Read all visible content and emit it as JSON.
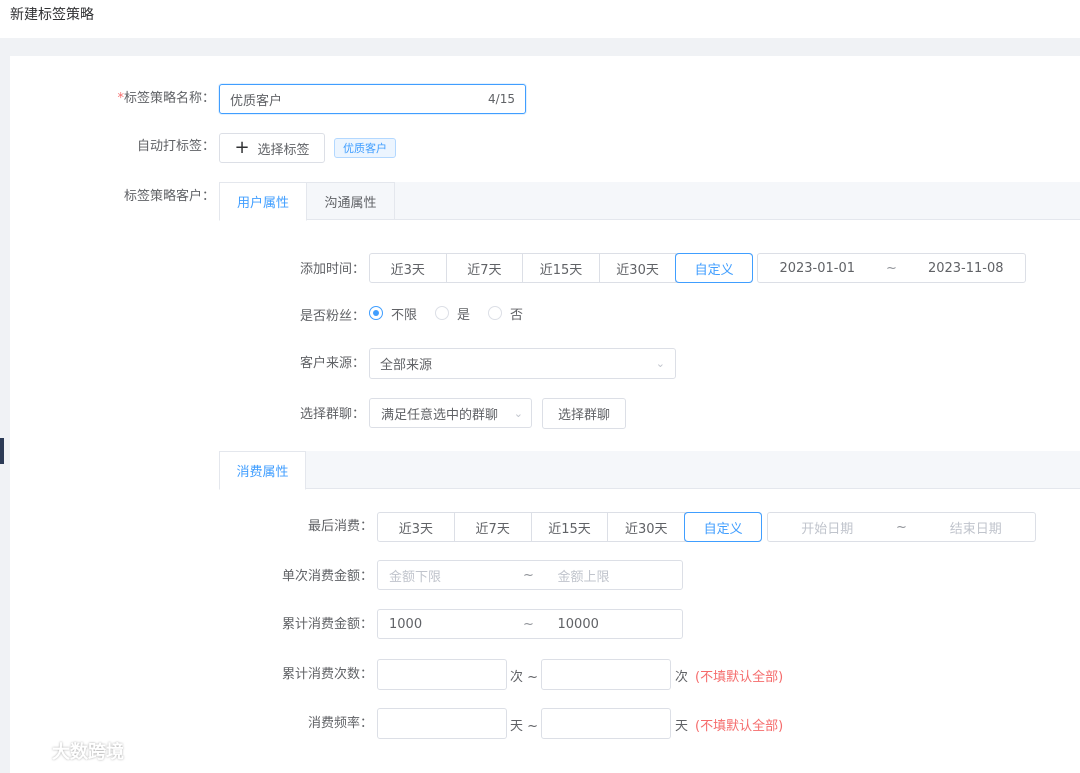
{
  "page_title": "新建标签策略",
  "form": {
    "name_label_req": "*",
    "name_label": "标签策略名称：",
    "name_value": "优质客户",
    "name_counter": "4/15",
    "auto_tag_label": "自动打标签：",
    "select_tag_button": "选择标签",
    "selected_tag": "优质客户",
    "customers_label": "标签策略客户："
  },
  "tabs": [
    {
      "label": "用户属性",
      "active": true
    },
    {
      "label": "沟通属性",
      "active": false
    }
  ],
  "user_attr": {
    "add_time_label": "添加时间：",
    "add_time_options": [
      "近3天",
      "近7天",
      "近15天",
      "近30天",
      "自定义"
    ],
    "add_time_active": "自定义",
    "add_time_start": "2023-01-01",
    "add_time_sep": "~",
    "add_time_end": "2023-11-08",
    "fan_label": "是否粉丝：",
    "fan_options": [
      "不限",
      "是",
      "否"
    ],
    "fan_selected": "不限",
    "source_label": "客户来源：",
    "source_value": "全部来源",
    "group_label": "选择群聊：",
    "group_mode_value": "满足任意选中的群聊",
    "group_select_button": "选择群聊"
  },
  "consume_tab": "消费属性",
  "consume": {
    "last_label": "最后消费：",
    "last_options": [
      "近3天",
      "近7天",
      "近15天",
      "近30天",
      "自定义"
    ],
    "last_active": "自定义",
    "last_start_ph": "开始日期",
    "last_sep": "~",
    "last_end_ph": "结束日期",
    "single_label": "单次消费金额：",
    "single_min_ph": "金额下限",
    "single_sep": "~",
    "single_max_ph": "金额上限",
    "total_label": "累计消费金额：",
    "total_min": "1000",
    "total_sep": "~",
    "total_max": "10000",
    "count_label": "累计消费次数：",
    "count_unit_1": "次 ~",
    "count_unit_2": "次",
    "count_hint": "(不填默认全部)",
    "freq_label": "消费频率：",
    "freq_unit_1": "天 ~",
    "freq_unit_2": "天",
    "freq_hint": "(不填默认全部)"
  },
  "watermark_text": "大数跨境",
  "colors": {
    "primary": "#409eff",
    "danger": "#f56c6c",
    "border": "#dcdfe6"
  }
}
